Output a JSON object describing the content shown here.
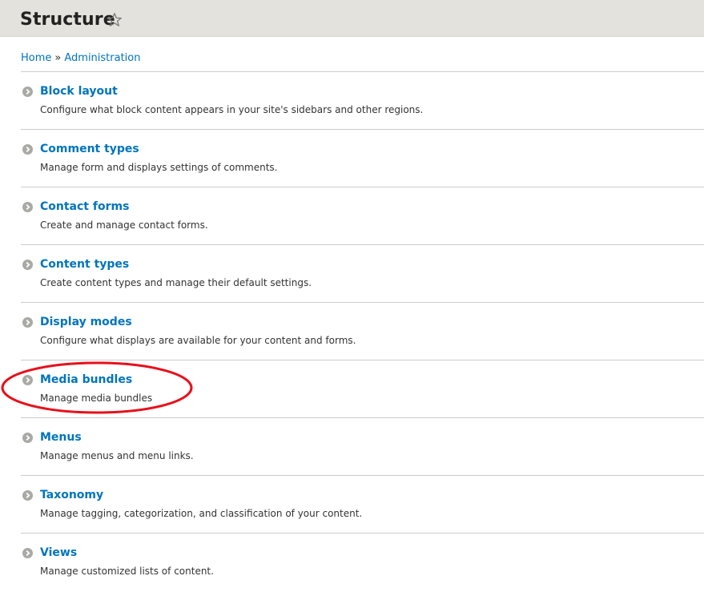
{
  "page": {
    "title": "Structure"
  },
  "breadcrumb": {
    "home": "Home",
    "separator": "»",
    "administration": "Administration"
  },
  "items": [
    {
      "title": "Block layout",
      "description": "Configure what block content appears in your site's sidebars and other regions."
    },
    {
      "title": "Comment types",
      "description": "Manage form and displays settings of comments."
    },
    {
      "title": "Contact forms",
      "description": "Create and manage contact forms."
    },
    {
      "title": "Content types",
      "description": "Create content types and manage their default settings."
    },
    {
      "title": "Display modes",
      "description": "Configure what displays are available for your content and forms."
    },
    {
      "title": "Media bundles",
      "description": "Manage media bundles"
    },
    {
      "title": "Menus",
      "description": "Manage menus and menu links."
    },
    {
      "title": "Taxonomy",
      "description": "Manage tagging, categorization, and classification of your content."
    },
    {
      "title": "Views",
      "description": "Manage customized lists of content."
    }
  ],
  "icons": {
    "favorite": "star-outline-icon",
    "item_bullet": "circle-arrow-right-icon"
  },
  "colors": {
    "link": "#0074bd",
    "header_bg": "#e3e2dc",
    "highlight": "#e8101a"
  }
}
